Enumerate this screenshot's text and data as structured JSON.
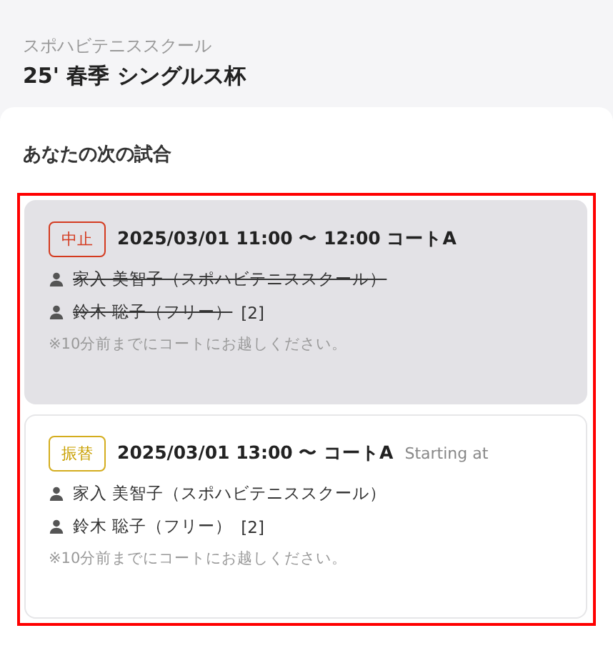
{
  "header": {
    "school": "スポハビテニススクール",
    "title": "25' 春季 シングルス杯"
  },
  "section": {
    "title": "あなたの次の試合",
    "highlighted": true
  },
  "matches": [
    {
      "kind": "cancelled",
      "badge": "中止",
      "schedule": "2025/03/01 11:00 〜 12:00 コートA",
      "players": [
        {
          "name": "家入 美智子（スポハビテニススクール）",
          "struck": true
        },
        {
          "name": "鈴木 聡子（フリー）",
          "struck": true,
          "suffix": "[2]"
        }
      ],
      "note": "※10分前までにコートにお越しください。"
    },
    {
      "kind": "rescheduled",
      "badge": "振替",
      "schedule": "2025/03/01 13:00 〜 コートA",
      "hint": "Starting at",
      "players": [
        {
          "name": "家入 美智子（スポハビテニススクール）",
          "struck": false
        },
        {
          "name": "鈴木 聡子（フリー）",
          "struck": false,
          "suffix": "[2]"
        }
      ],
      "note": "※10分前までにコートにお越しください。"
    }
  ]
}
